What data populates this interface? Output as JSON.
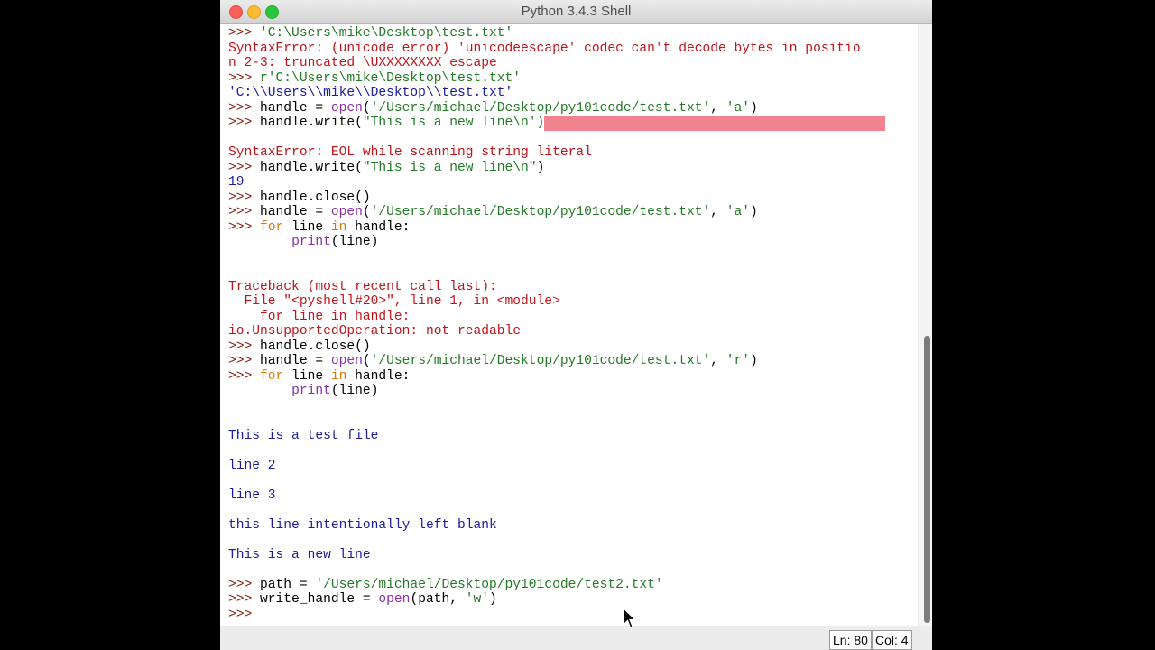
{
  "window": {
    "title": "Python 3.4.3 Shell"
  },
  "shell": {
    "lines": [
      [
        {
          "t": ">>> ",
          "c": "prompt"
        },
        {
          "t": "'C:\\Users\\mike\\Desktop\\test.txt'",
          "c": "str"
        }
      ],
      [
        {
          "t": "SyntaxError: (unicode error) 'unicodeescape' codec can't decode bytes in positio",
          "c": "err"
        }
      ],
      [
        {
          "t": "n 2-3: truncated \\UXXXXXXXX escape",
          "c": "err"
        }
      ],
      [
        {
          "t": ">>> ",
          "c": "prompt"
        },
        {
          "t": "r'C:\\Users\\mike\\Desktop\\test.txt'",
          "c": "str"
        }
      ],
      [
        {
          "t": "'C:\\\\Users\\\\mike\\\\Desktop\\\\test.txt'",
          "c": "out"
        }
      ],
      [
        {
          "t": ">>> ",
          "c": "prompt"
        },
        {
          "t": "handle = ",
          "c": "code"
        },
        {
          "t": "open",
          "c": "builtin"
        },
        {
          "t": "(",
          "c": "code"
        },
        {
          "t": "'/Users/michael/Desktop/py101code/test.txt'",
          "c": "str"
        },
        {
          "t": ", ",
          "c": "code"
        },
        {
          "t": "'a'",
          "c": "str"
        },
        {
          "t": ")",
          "c": "code"
        }
      ],
      [
        {
          "t": ">>> ",
          "c": "prompt"
        },
        {
          "t": "handle.write(",
          "c": "code"
        },
        {
          "t": "\"This is a new line\\n')",
          "c": "str"
        },
        {
          "t": "",
          "c": "errhl"
        }
      ],
      [],
      [
        {
          "t": "SyntaxError: EOL while scanning string literal",
          "c": "err"
        }
      ],
      [
        {
          "t": ">>> ",
          "c": "prompt"
        },
        {
          "t": "handle.write(",
          "c": "code"
        },
        {
          "t": "\"This is a new line\\n\"",
          "c": "str"
        },
        {
          "t": ")",
          "c": "code"
        }
      ],
      [
        {
          "t": "19",
          "c": "out"
        }
      ],
      [
        {
          "t": ">>> ",
          "c": "prompt"
        },
        {
          "t": "handle.close()",
          "c": "code"
        }
      ],
      [
        {
          "t": ">>> ",
          "c": "prompt"
        },
        {
          "t": "handle = ",
          "c": "code"
        },
        {
          "t": "open",
          "c": "builtin"
        },
        {
          "t": "(",
          "c": "code"
        },
        {
          "t": "'/Users/michael/Desktop/py101code/test.txt'",
          "c": "str"
        },
        {
          "t": ", ",
          "c": "code"
        },
        {
          "t": "'a'",
          "c": "str"
        },
        {
          "t": ")",
          "c": "code"
        }
      ],
      [
        {
          "t": ">>> ",
          "c": "prompt"
        },
        {
          "t": "for",
          "c": "kw"
        },
        {
          "t": " line ",
          "c": "code"
        },
        {
          "t": "in",
          "c": "kw"
        },
        {
          "t": " handle:",
          "c": "code"
        }
      ],
      [
        {
          "t": "        ",
          "c": "code"
        },
        {
          "t": "print",
          "c": "builtin"
        },
        {
          "t": "(line)",
          "c": "code"
        }
      ],
      [],
      [],
      [
        {
          "t": "Traceback (most recent call last):",
          "c": "err"
        }
      ],
      [
        {
          "t": "  File \"<pyshell#20>\", line 1, in <module>",
          "c": "err"
        }
      ],
      [
        {
          "t": "    for line in handle:",
          "c": "err"
        }
      ],
      [
        {
          "t": "io.UnsupportedOperation: not readable",
          "c": "err"
        }
      ],
      [
        {
          "t": ">>> ",
          "c": "prompt"
        },
        {
          "t": "handle.close()",
          "c": "code"
        }
      ],
      [
        {
          "t": ">>> ",
          "c": "prompt"
        },
        {
          "t": "handle = ",
          "c": "code"
        },
        {
          "t": "open",
          "c": "builtin"
        },
        {
          "t": "(",
          "c": "code"
        },
        {
          "t": "'/Users/michael/Desktop/py101code/test.txt'",
          "c": "str"
        },
        {
          "t": ", ",
          "c": "code"
        },
        {
          "t": "'r'",
          "c": "str"
        },
        {
          "t": ")",
          "c": "code"
        }
      ],
      [
        {
          "t": ">>> ",
          "c": "prompt"
        },
        {
          "t": "for",
          "c": "kw"
        },
        {
          "t": " line ",
          "c": "code"
        },
        {
          "t": "in",
          "c": "kw"
        },
        {
          "t": " handle:",
          "c": "code"
        }
      ],
      [
        {
          "t": "        ",
          "c": "code"
        },
        {
          "t": "print",
          "c": "builtin"
        },
        {
          "t": "(line)",
          "c": "code"
        }
      ],
      [],
      [],
      [
        {
          "t": "This is a test file",
          "c": "out"
        }
      ],
      [],
      [
        {
          "t": "line 2",
          "c": "out"
        }
      ],
      [],
      [
        {
          "t": "line 3",
          "c": "out"
        }
      ],
      [],
      [
        {
          "t": "this line intentionally left blank",
          "c": "out"
        }
      ],
      [],
      [
        {
          "t": "This is a new line",
          "c": "out"
        }
      ],
      [],
      [
        {
          "t": ">>> ",
          "c": "prompt"
        },
        {
          "t": "path = ",
          "c": "code"
        },
        {
          "t": "'/Users/michael/Desktop/py101code/test2.txt'",
          "c": "str"
        }
      ],
      [
        {
          "t": ">>> ",
          "c": "prompt"
        },
        {
          "t": "write_handle = ",
          "c": "code"
        },
        {
          "t": "open",
          "c": "builtin"
        },
        {
          "t": "(path, ",
          "c": "code"
        },
        {
          "t": "'w'",
          "c": "str"
        },
        {
          "t": ")",
          "c": "code"
        }
      ],
      [
        {
          "t": ">>> ",
          "c": "prompt"
        }
      ]
    ]
  },
  "status": {
    "ln": "Ln: 80",
    "col": "Col: 4"
  },
  "icons": {
    "close": "close-icon",
    "minimize": "minimize-icon",
    "maximize": "maximize-icon",
    "cursor": "mouse-pointer-icon"
  },
  "colors": {
    "prompt": "#7d1e10",
    "string": "#237a24",
    "builtin": "#8a2fa8",
    "keyword": "#d87a0b",
    "error": "#c0141a",
    "output": "#1b1b9e",
    "error_highlight": "#f28390"
  }
}
